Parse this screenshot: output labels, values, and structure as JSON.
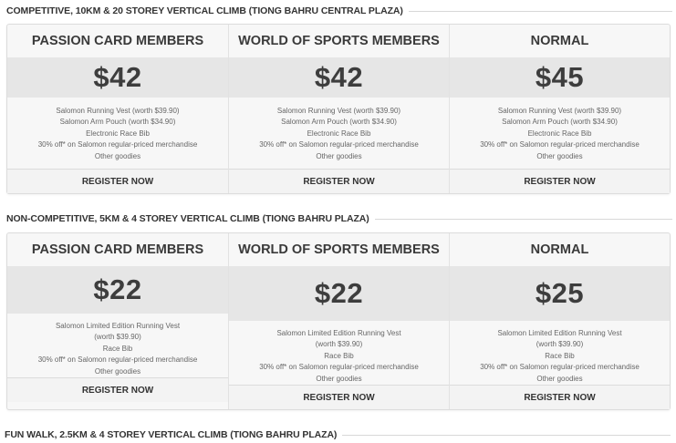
{
  "sections": [
    {
      "heading": "COMPETITIVE, 10KM & 20 STOREY VERTICAL CLIMB (TIONG BAHRU CENTRAL PLAZA)",
      "tiers": [
        {
          "name": "PASSION CARD MEMBERS",
          "price": "$42",
          "features": [
            "Salomon Running Vest (worth $39.90)",
            "Salomon Arm Pouch (worth $34.90)",
            "Electronic Race Bib",
            "30% off* on Salomon regular-priced merchandise",
            "Other goodies"
          ],
          "cta": "REGISTER NOW"
        },
        {
          "name": "WORLD OF SPORTS MEMBERS",
          "price": "$42",
          "features": [
            "Salomon Running Vest (worth $39.90)",
            "Salomon Arm Pouch (worth $34.90)",
            "Electronic Race Bib",
            "30% off* on Salomon regular-priced merchandise",
            "Other goodies"
          ],
          "cta": "REGISTER NOW"
        },
        {
          "name": "NORMAL",
          "price": "$45",
          "features": [
            "Salomon Running Vest (worth $39.90)",
            "Salomon Arm Pouch (worth $34.90)",
            "Electronic Race Bib",
            "30% off* on Salomon regular-priced merchandise",
            "Other goodies"
          ],
          "cta": "REGISTER NOW"
        }
      ]
    },
    {
      "heading": "NON-COMPETITIVE, 5KM & 4 STOREY VERTICAL CLIMB (TIONG BAHRU PLAZA)",
      "tiers": [
        {
          "name": "PASSION CARD MEMBERS",
          "price": "$22",
          "features": [
            "Salomon Limited Edition Running Vest",
            "(worth $39.90)",
            "Race Bib",
            "30% off* on Salomon regular-priced merchandise",
            "Other goodies"
          ],
          "cta": "REGISTER NOW"
        },
        {
          "name": "WORLD OF SPORTS MEMBERS",
          "price": "$22",
          "features": [
            "Salomon Limited Edition Running Vest",
            "(worth $39.90)",
            "Race Bib",
            "30% off* on Salomon regular-priced merchandise",
            "Other goodies"
          ],
          "cta": "REGISTER NOW"
        },
        {
          "name": "NORMAL",
          "price": "$25",
          "features": [
            "Salomon Limited Edition Running Vest",
            "(worth $39.90)",
            "Race Bib",
            "30% off* on Salomon regular-priced merchandise",
            "Other goodies"
          ],
          "cta": "REGISTER NOW"
        }
      ]
    },
    {
      "heading": "FUN WALK, 2.5KM & 4 STOREY VERTICAL CLIMB (TIONG BAHRU PLAZA)"
    }
  ]
}
